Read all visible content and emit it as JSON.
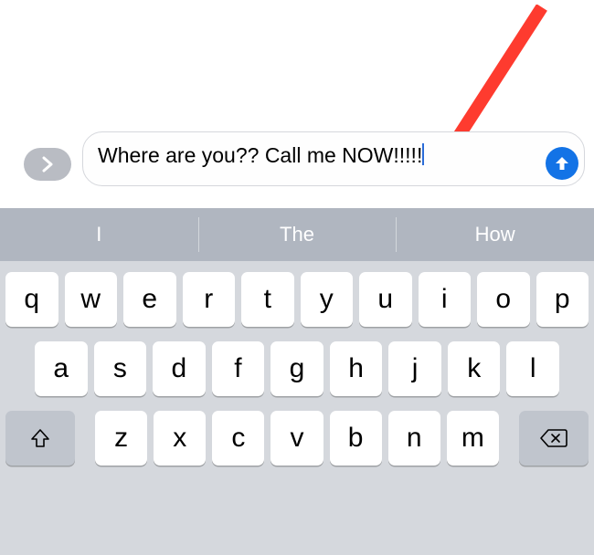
{
  "compose": {
    "message_text": "Where are you?? Call me NOW!!!!!",
    "expand_label": "expand"
  },
  "predictions": [
    "I",
    "The",
    "How"
  ],
  "keyboard": {
    "row1": [
      "q",
      "w",
      "e",
      "r",
      "t",
      "y",
      "u",
      "i",
      "o",
      "p"
    ],
    "row2": [
      "a",
      "s",
      "d",
      "f",
      "g",
      "h",
      "j",
      "k",
      "l"
    ],
    "row3": [
      "z",
      "x",
      "c",
      "v",
      "b",
      "n",
      "m"
    ]
  },
  "colors": {
    "send_button": "#1373e6",
    "arrow": "#fe3b2f"
  }
}
